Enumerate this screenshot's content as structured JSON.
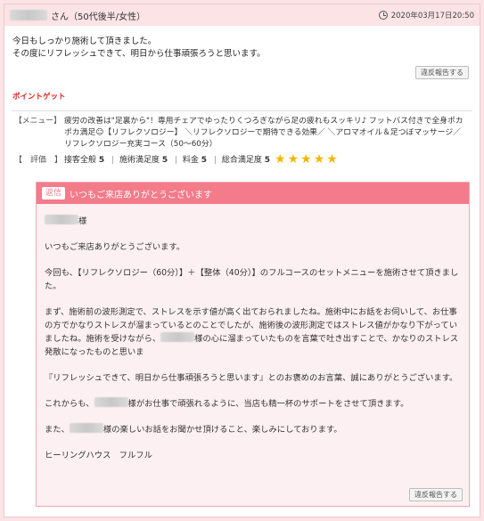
{
  "header": {
    "reviewer_suffix": "さん（50代後半/女性）",
    "datetime": "2020年03月17日20:50"
  },
  "review": {
    "lines": [
      "今日もしっかり施術して頂きました。",
      "その度にリフレッシュできて、明日から仕事頑張ろうと思います。"
    ],
    "report_label": "違反報告する",
    "point_get": "ポイントゲット"
  },
  "menu": {
    "label": "【メニュー】",
    "lines": [
      "疲労の改善は\"足裏から\"！専用チェアでゆったりくつろぎながら足の疲れもスッキリ♪ フットバス付きで全身ポカポカ満足☺【リフレクソロジー】 ＼リフレクソロジーで期待できる効果／ ＼アロマオイル＆足つぼマッサージ／ リフレクソロジー充実コース（50～60分）"
    ]
  },
  "rating": {
    "label": "【　評価　】",
    "items": [
      {
        "name": "接客全般",
        "value": "5"
      },
      {
        "name": "施術満足度",
        "value": "5"
      },
      {
        "name": "料金",
        "value": "5"
      },
      {
        "name": "総合満足度",
        "value": "5"
      }
    ],
    "stars": 5,
    "star_color": "#f2b705"
  },
  "reply": {
    "badge": "返信",
    "title": "いつもご来店ありがとうございます",
    "salutation_suffix": "様",
    "p1": "いつもご来店ありがとうございます。",
    "p2": "今回も、【リフレクソロジー（60分）】＋【整体（40分）】のフルコースのセットメニューを施術させて頂きました。",
    "p3a": "まず、施術前の波形測定で、ストレスを示す値が高く出ておられましたね。施術中にお話をお伺いして、お仕事の方でかなりストレスが溜まっているとのことでしたが、施術後の波形測定ではストレス値がかなり下がっていましたね。施術を受けながら、",
    "p3b": "様の心に溜まっていたものを言葉で吐き出すことで、かなりのストレス発散になったものと思いま",
    "p4": "『リフレッシュできて、明日から仕事頑張ろうと思います』とのお褒めのお言葉、誠にありがとうございます。",
    "p5a": "これからも、",
    "p5b": "様がお仕事で頑張れるように、当店も精一杯のサポートをさせて頂きます。",
    "p6a": "また、",
    "p6b": "様の楽しいお話をお聞かせ頂けること、楽しみにしております。",
    "signature": "ヒーリングハウス　フルフル",
    "report_label": "違反報告する"
  },
  "colors": {
    "background": "#fbe3e6",
    "accent": "#f37b8a",
    "point_red": "#e0231f"
  }
}
